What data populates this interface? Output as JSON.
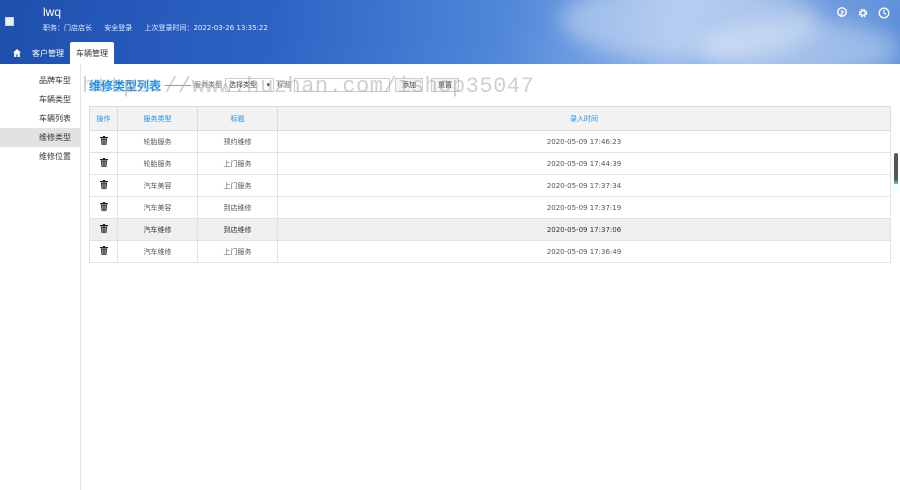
{
  "header": {
    "app_name": "lwq",
    "role": "职务：门店店长",
    "logout": "安全登录",
    "last_login": "上次登录时间：2022-03-26 13:35:22"
  },
  "icons": {
    "home": "home-icon",
    "skin": "skin-icon",
    "settings": "gear-icon",
    "clock": "clock-icon",
    "delete": "trash-icon"
  },
  "topnav": {
    "tabs": [
      {
        "label": "客户管理"
      },
      {
        "label": "车辆管理"
      }
    ]
  },
  "sidebar": {
    "items": [
      {
        "label": "品牌车型"
      },
      {
        "label": "车辆类型"
      },
      {
        "label": "车辆列表"
      },
      {
        "label": "维修类型"
      },
      {
        "label": "维修位置"
      }
    ]
  },
  "toolbar": {
    "page_title": "维修类型列表",
    "filter_label": "服务类型",
    "select_value": "选择类型",
    "title_label": "标题",
    "search_placeholder": "",
    "add_label": "添加",
    "reset_label": "重置"
  },
  "table": {
    "headers": [
      "操作",
      "服务类型",
      "标题",
      "录入时间"
    ],
    "rows": [
      {
        "type": "轮胎服务",
        "title": "预约维修",
        "time": "2020-05-09 17:46:23"
      },
      {
        "type": "轮胎服务",
        "title": "上门服务",
        "time": "2020-05-09 17:44:39"
      },
      {
        "type": "汽车美容",
        "title": "上门服务",
        "time": "2020-05-09 17:37:34"
      },
      {
        "type": "汽车美容",
        "title": "到店维修",
        "time": "2020-05-09 17:37:19"
      },
      {
        "type": "汽车维修",
        "title": "到店维修",
        "time": "2020-05-09 17:37:06"
      },
      {
        "type": "汽车维修",
        "title": "上门服务",
        "time": "2020-05-09 17:36:49"
      }
    ]
  },
  "watermark": "https://www.huzhan.com/ishop35047",
  "colors": {
    "accent": "#1f8ee8",
    "header_start": "#1e4fae",
    "header_end": "#8fb3e8",
    "selected_row": "#efefef"
  }
}
